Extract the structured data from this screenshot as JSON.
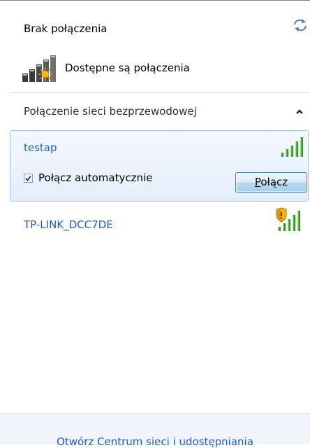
{
  "header": {
    "status": "Brak połączenia",
    "available": "Dostępne są połączenia"
  },
  "section": {
    "title": "Połączenie sieci bezprzewodowej"
  },
  "networks": [
    {
      "name": "testap",
      "secured": false,
      "signal_bars": 5,
      "selected": true
    },
    {
      "name": "TP-LINK_DCC7DE",
      "secured": true,
      "signal_bars": 5,
      "selected": false
    }
  ],
  "selected_network": {
    "auto_connect_label": "Połącz automatycznie",
    "auto_connect_checked": true,
    "connect_button_accel": "P",
    "connect_button_rest": "ołącz"
  },
  "footer": {
    "link": "Otwórz Centrum sieci i udostępniania"
  },
  "colors": {
    "link_blue": "#1f5fc0",
    "signal_green": "#2f9a1f",
    "selection_border": "#a7c3e6"
  },
  "icons": [
    "refresh-icon",
    "network-available-icon",
    "collapse-chevron-icon",
    "signal-strength-icon",
    "shield-icon",
    "checkmark-icon"
  ]
}
